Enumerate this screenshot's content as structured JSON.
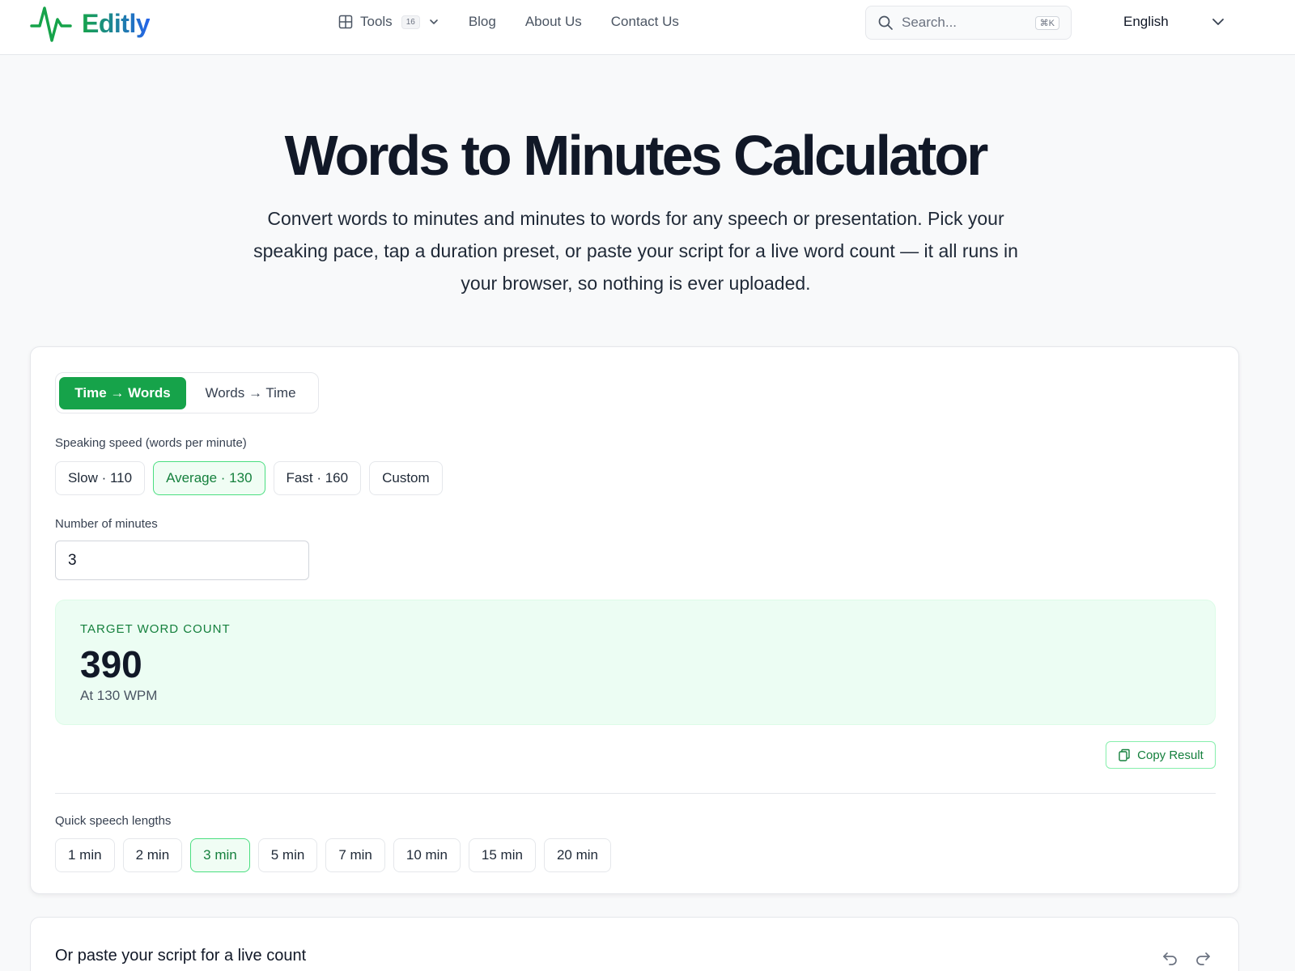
{
  "brand": {
    "name": "Editly",
    "accent": "#16a34a",
    "accent_blue": "#2563eb"
  },
  "nav": {
    "tools_label": "Tools",
    "tools_count": "16",
    "links": [
      "Blog",
      "About Us",
      "Contact Us"
    ]
  },
  "search": {
    "placeholder": "Search...",
    "shortcut": "⌘K"
  },
  "language": {
    "selected": "English"
  },
  "hero": {
    "title": "Words to Minutes Calculator",
    "subtitle": "Convert words to minutes and minutes to words for any speech or presentation. Pick your speaking pace, tap a duration preset, or paste your script for a live word count — it all runs in your browser, so nothing is ever uploaded."
  },
  "calculator": {
    "modes": [
      "Time → Words",
      "Words → Time"
    ],
    "active_mode": "Time → Words",
    "speed_label": "Speaking speed (words per minute)",
    "speeds": [
      "Slow · 110",
      "Average · 130",
      "Fast · 160",
      "Custom"
    ],
    "selected_speed": "Average · 130",
    "minutes_label": "Number of minutes",
    "minutes_value": "3",
    "result_label": "TARGET WORD COUNT",
    "result_value": "390",
    "result_sub": "At 130 WPM",
    "copy_label": "Copy Result",
    "quick_label": "Quick speech lengths",
    "quick_lengths": [
      "1 min",
      "2 min",
      "3 min",
      "5 min",
      "7 min",
      "10 min",
      "15 min",
      "20 min"
    ],
    "selected_quick": "3 min"
  },
  "script_section": {
    "title": "Or paste your script for a live count"
  }
}
